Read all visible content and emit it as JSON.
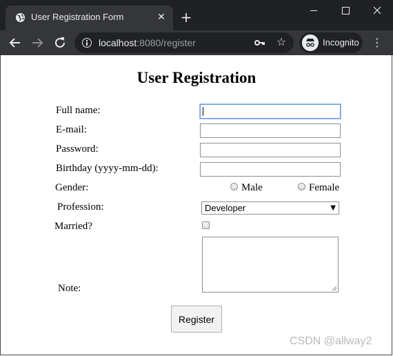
{
  "browser": {
    "tab_title": "User Registration Form",
    "url_host": "localhost",
    "url_rest": ":8080/register",
    "incognito_label": "Incognito",
    "icons": {
      "favicon": "globe-icon",
      "tab_close": "close-icon",
      "new_tab": "plus-icon",
      "back": "arrow-left-icon",
      "forward": "arrow-right-icon",
      "reload": "reload-icon",
      "site_info": "info-icon",
      "passwords": "key-icon",
      "bookmark": "star-icon",
      "menu": "kebab-menu-icon"
    },
    "colors": {
      "titlebar": "#202124",
      "toolbar": "#35363a",
      "text": "#e8eaed"
    }
  },
  "form": {
    "title": "User Registration",
    "fields": {
      "fullname": {
        "label": "Full name:",
        "value": ""
      },
      "email": {
        "label": "E-mail:",
        "value": ""
      },
      "password": {
        "label": "Password:",
        "value": ""
      },
      "birthday": {
        "label": "Birthday (yyyy-mm-dd):",
        "value": ""
      }
    },
    "gender": {
      "label": "Gender:",
      "options": [
        "Male",
        "Female"
      ],
      "selected": null
    },
    "profession": {
      "label": "Profession:",
      "selected": "Developer"
    },
    "married": {
      "label": "Married?",
      "checked": false
    },
    "note": {
      "label": "Note:",
      "value": ""
    },
    "register_label": "Register"
  },
  "watermark": "CSDN @allway2"
}
